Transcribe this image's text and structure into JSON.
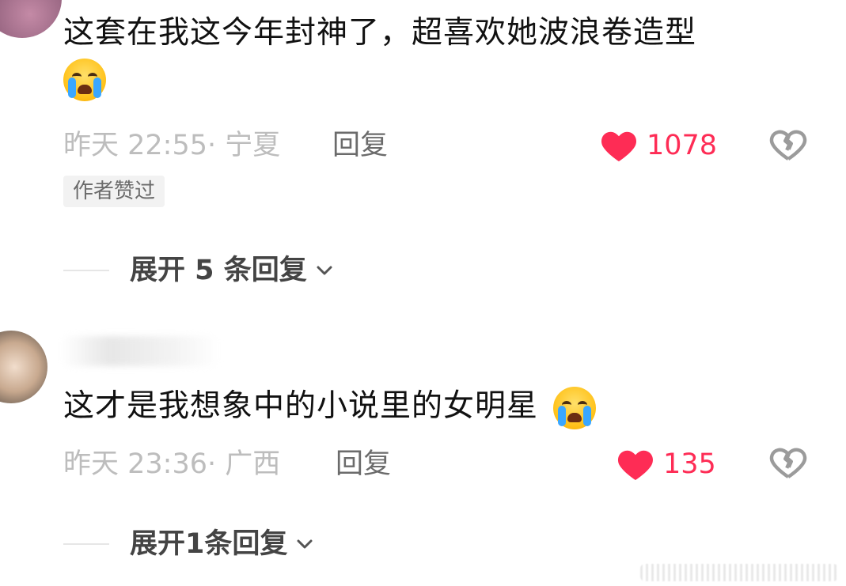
{
  "comments": [
    {
      "text": "这套在我这今年封神了，超喜欢她波浪卷造型",
      "timestamp": "昨天 22:55· 宁夏",
      "reply_label": "回复",
      "likes": "1078",
      "badge": "作者赞过",
      "expand_label": "展开 5 条回复"
    },
    {
      "text": "这才是我想象中的小说里的女明星",
      "timestamp": "昨天 23:36· 广西",
      "reply_label": "回复",
      "likes": "135",
      "expand_label": "展开1条回复"
    }
  ],
  "icons": {
    "emoji": "loudly-crying-face-icon",
    "like": "heart-icon",
    "dislike": "broken-heart-icon",
    "expand": "chevron-down-icon"
  },
  "colors": {
    "like": "#fe2c55",
    "meta": "#bdbdbd",
    "reply": "#6b6b6b"
  }
}
